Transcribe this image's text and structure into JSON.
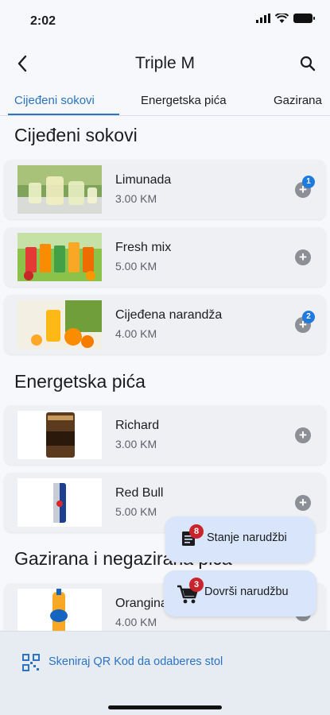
{
  "status": {
    "time": "2:02"
  },
  "header": {
    "title": "Triple M"
  },
  "tabs": [
    {
      "label": "Cijeđeni sokovi",
      "active": true
    },
    {
      "label": "Energetska pića",
      "active": false
    },
    {
      "label": "Gazirana",
      "active": false
    }
  ],
  "sections": [
    {
      "title": "Cijeđeni sokovi",
      "items": [
        {
          "name": "Limunada",
          "price": "3.00 KM",
          "count": "1"
        },
        {
          "name": "Fresh mix",
          "price": "5.00 KM",
          "count": ""
        },
        {
          "name": "Cijeđena narandža",
          "price": "4.00 KM",
          "count": "2"
        }
      ]
    },
    {
      "title": "Energetska pića",
      "items": [
        {
          "name": "Richard",
          "price": "3.00 KM",
          "count": ""
        },
        {
          "name": "Red Bull",
          "price": "5.00 KM",
          "count": ""
        }
      ]
    },
    {
      "title": "Gazirana i negazirana pića",
      "items": [
        {
          "name": "Orangina",
          "price": "4.00 KM",
          "count": ""
        }
      ]
    }
  ],
  "fabs": {
    "order_status": {
      "label": "Stanje narudžbi",
      "badge": "8"
    },
    "finish_order": {
      "label": "Dovrši narudžbu",
      "badge": "3"
    }
  },
  "footer": {
    "qr_text": "Skeniraj QR Kod da odaberes stol"
  },
  "colors": {
    "accent": "#2a73c7",
    "badge_red": "#c9242b",
    "badge_blue": "#1f7ae0",
    "fab_bg": "#d8e5fa"
  }
}
